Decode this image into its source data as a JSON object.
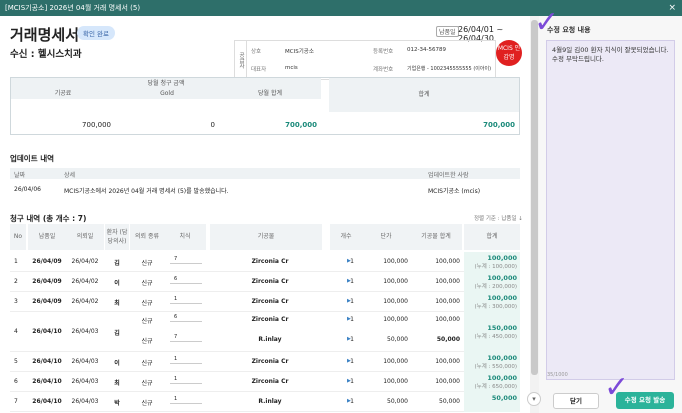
{
  "window": {
    "title": "[MCIS기공소] 2026년 04월 거래 명세서 (5)",
    "close": "×"
  },
  "doc": {
    "heading": "거래명세서",
    "status_badge": "확인 완료",
    "recipient": "수신 : 헬시스치과",
    "date_label": "납품일",
    "date_range": "26/04/01 ~ 26/04/30",
    "supplier": {
      "side_label": "공급자",
      "labels": [
        "상호",
        "대표자",
        "등록번호",
        "계좌번호"
      ],
      "values": [
        "MCIS기공소",
        "mcis",
        "012-34-56789",
        "기업은행 - 1002345555555 (이아이)"
      ]
    },
    "stamp": "MCIS 인감명",
    "summary": {
      "group_header": "당월 청구 금액",
      "col_labels": [
        "기공료",
        "Gold",
        "당월 합계",
        "합계"
      ],
      "values": [
        "700,000",
        "0",
        "700,000",
        "700,000"
      ]
    },
    "updates": {
      "title": "업데이트 내역",
      "headers": [
        "날짜",
        "상세",
        "업데이트한 사람"
      ],
      "rows": [
        {
          "date": "26/04/06",
          "detail": "MCIS기공소에서 2026년 04월 거래 명세서 (5)를 발송했습니다.",
          "who": "MCIS기공소 (mcis)"
        }
      ]
    },
    "items": {
      "title": "청구 내역 (총 개수 : 7)",
      "sort_note": "정렬 기준 : 납품일 ↓",
      "headers": [
        "No",
        "납품일",
        "의뢰일",
        "환자 (담당의사)",
        "의뢰 종류",
        "치식",
        "기공물",
        "개수",
        "단가",
        "기공물 합계",
        "합계"
      ],
      "rows": [
        {
          "no": "1",
          "delivery": "26/04/09",
          "request": "26/04/02",
          "patient": "김",
          "type": "신규",
          "tooth": "7",
          "product": "Zirconia Cr",
          "count": "1",
          "price": "100,000",
          "subtotal": "100,000",
          "total": "100,000",
          "cum": "(누계 : 100,000)"
        },
        {
          "no": "2",
          "delivery": "26/04/09",
          "request": "26/04/02",
          "patient": "이",
          "type": "신규",
          "tooth": "6",
          "product": "Zirconia Cr",
          "count": "1",
          "price": "100,000",
          "subtotal": "100,000",
          "total": "100,000",
          "cum": "(누계 : 200,000)"
        },
        {
          "no": "3",
          "delivery": "26/04/09",
          "request": "26/04/02",
          "patient": "최",
          "type": "신규",
          "tooth": "1",
          "product": "Zirconia Cr",
          "count": "1",
          "price": "100,000",
          "subtotal": "100,000",
          "total": "100,000",
          "cum": "(누계 : 300,000)"
        },
        {
          "no": "4",
          "delivery": "26/04/10",
          "request": "26/04/03",
          "patient": "김",
          "type": "신규",
          "tooth": "6",
          "product": "Zirconia Cr",
          "count": "1",
          "price": "100,000",
          "subtotal": "100,000",
          "total": "150,000",
          "cum": "(누계 : 450,000)",
          "sub": {
            "type": "신규",
            "tooth": "7",
            "product": "R.inlay",
            "count": "1",
            "price": "50,000",
            "subtotal": "50,000"
          }
        },
        {
          "no": "5",
          "delivery": "26/04/10",
          "request": "26/04/03",
          "patient": "이",
          "type": "신규",
          "tooth": "1",
          "product": "Zirconia Cr",
          "count": "1",
          "price": "100,000",
          "subtotal": "100,000",
          "total": "100,000",
          "cum": "(누계 : 550,000)"
        },
        {
          "no": "6",
          "delivery": "26/04/10",
          "request": "26/04/03",
          "patient": "최",
          "type": "신규",
          "tooth": "1",
          "product": "Zirconia Cr",
          "count": "1",
          "price": "100,000",
          "subtotal": "100,000",
          "total": "100,000",
          "cum": "(누계 : 650,000)"
        },
        {
          "no": "7",
          "delivery": "26/04/10",
          "request": "26/04/03",
          "patient": "박",
          "type": "신규",
          "tooth": "1",
          "product": "R.inlay",
          "count": "1",
          "price": "50,000",
          "subtotal": "50,000",
          "total": "50,000",
          "cum": ""
        }
      ]
    }
  },
  "request_panel": {
    "title": "수정 요청 내용",
    "text": "4월9일 김00 환자 치식이 잘못되었습니다. 수정 부탁드립니다.",
    "counter": "35/1000",
    "close_label": "닫기",
    "send_label": "수정 요청 발송"
  },
  "colors": {
    "accent": "#2bb39a",
    "titlebar": "#2e6f6a",
    "request_bg": "#ece9f6",
    "stamp": "#e02020"
  }
}
